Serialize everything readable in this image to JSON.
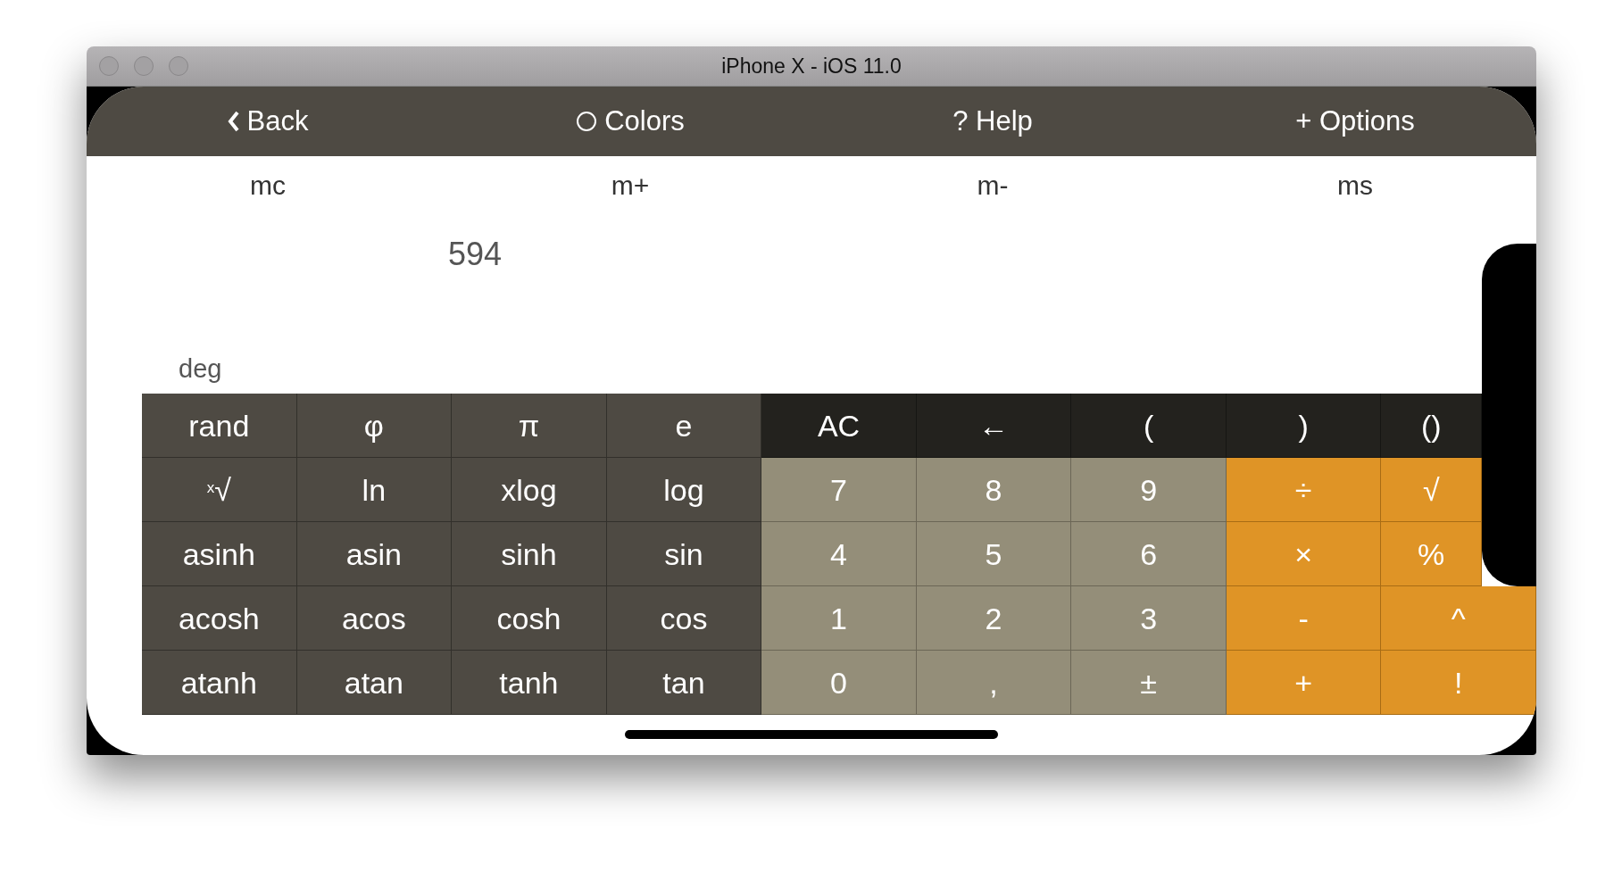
{
  "window": {
    "title": "iPhone X - iOS 11.0"
  },
  "nav": [
    {
      "label": "Back",
      "kind": "chevron"
    },
    {
      "label": "Colors",
      "kind": "circle"
    },
    {
      "label": "? Help",
      "kind": "plain"
    },
    {
      "label": "+ Options",
      "kind": "plain"
    }
  ],
  "memory": [
    "mc",
    "m+",
    "m-",
    "ms"
  ],
  "display": {
    "history": "594",
    "angle_mode": "deg"
  },
  "keypad": [
    [
      {
        "label": "rand",
        "kind": "function"
      },
      {
        "label": "φ",
        "kind": "function"
      },
      {
        "label": "π",
        "kind": "function"
      },
      {
        "label": "e",
        "kind": "function"
      },
      {
        "label": "AC",
        "kind": "control"
      },
      {
        "label": "←",
        "kind": "control"
      },
      {
        "label": "(",
        "kind": "control"
      },
      {
        "label": ")",
        "kind": "control"
      },
      {
        "label": "()",
        "kind": "control"
      }
    ],
    [
      {
        "label": "$^{x}$√",
        "kind": "function"
      },
      {
        "label": "ln",
        "kind": "function"
      },
      {
        "label": "xlog",
        "kind": "function"
      },
      {
        "label": "log",
        "kind": "function"
      },
      {
        "label": "7",
        "kind": "digit"
      },
      {
        "label": "8",
        "kind": "digit"
      },
      {
        "label": "9",
        "kind": "digit"
      },
      {
        "label": "÷",
        "kind": "operator"
      },
      {
        "label": "√",
        "kind": "operator"
      }
    ],
    [
      {
        "label": "asinh",
        "kind": "function"
      },
      {
        "label": "asin",
        "kind": "function"
      },
      {
        "label": "sinh",
        "kind": "function"
      },
      {
        "label": "sin",
        "kind": "function"
      },
      {
        "label": "4",
        "kind": "digit"
      },
      {
        "label": "5",
        "kind": "digit"
      },
      {
        "label": "6",
        "kind": "digit"
      },
      {
        "label": "×",
        "kind": "operator"
      },
      {
        "label": "%",
        "kind": "operator"
      }
    ],
    [
      {
        "label": "acosh",
        "kind": "function"
      },
      {
        "label": "acos",
        "kind": "function"
      },
      {
        "label": "cosh",
        "kind": "function"
      },
      {
        "label": "cos",
        "kind": "function"
      },
      {
        "label": "1",
        "kind": "digit"
      },
      {
        "label": "2",
        "kind": "digit"
      },
      {
        "label": "3",
        "kind": "digit"
      },
      {
        "label": "-",
        "kind": "operator"
      },
      {
        "label": "^",
        "kind": "operator"
      }
    ],
    [
      {
        "label": "atanh",
        "kind": "function"
      },
      {
        "label": "atan",
        "kind": "function"
      },
      {
        "label": "tanh",
        "kind": "function"
      },
      {
        "label": "tan",
        "kind": "function"
      },
      {
        "label": "0",
        "kind": "digit"
      },
      {
        "label": ",",
        "kind": "digit"
      },
      {
        "label": "±",
        "kind": "digit"
      },
      {
        "label": "+",
        "kind": "operator"
      },
      {
        "label": "!",
        "kind": "operator"
      }
    ]
  ]
}
